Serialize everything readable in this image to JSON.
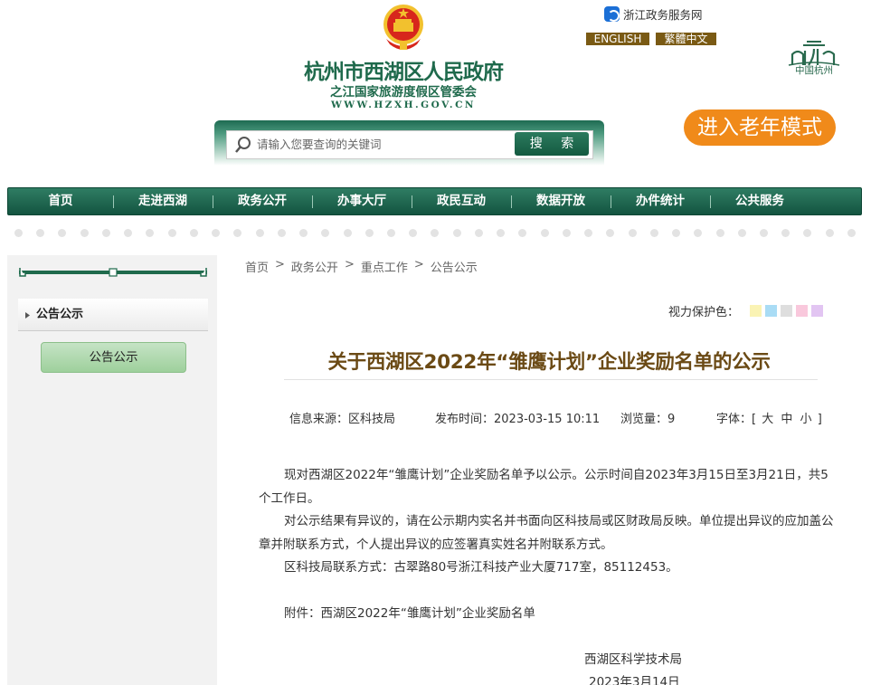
{
  "header": {
    "title": "杭州市西湖区人民政府",
    "subtitle": "之江国家旅游度假区管委会",
    "url": "WWW.HZXH.GOV.CN",
    "zj_link": "浙江政务服务网",
    "lang_en": "ENGLISH",
    "lang_tw": "繁體中文",
    "city_logo_text": "中国杭州",
    "elder_mode": "进入老年模式"
  },
  "search": {
    "placeholder": "请输入您要查询的关键词",
    "button": "搜 索"
  },
  "nav": [
    "首页",
    "走进西湖",
    "政务公开",
    "办事大厅",
    "政民互动",
    "数据开放",
    "办件统计",
    "公共服务"
  ],
  "sidebar": {
    "heading": "公告公示",
    "button": "公告公示"
  },
  "breadcrumb": [
    "首页",
    "政务公开",
    "重点工作",
    "公告公示"
  ],
  "vision": {
    "label": "视力保护色：",
    "colors": [
      "#faf3b4",
      "#a9dcf5",
      "#dedede",
      "#f9c8dc",
      "#e2c5f2"
    ]
  },
  "article": {
    "title": "关于西湖区2022年“雏鹰计划”企业奖励名单的公示",
    "source_label": "信息来源：",
    "source": "区科技局",
    "time_label": "发布时间：",
    "time": "2023-03-15 10:11",
    "views_label": "浏览量：",
    "views": "9",
    "font_label": "字体：",
    "font_open": "[",
    "font_large": "大",
    "font_medium": "中",
    "font_small": "小",
    "font_close": "]",
    "p1": "现对西湖区2022年“雏鹰计划”企业奖励名单予以公示。公示时间自2023年3月15日至3月21日，共5个工作日。",
    "p2": "对公示结果有异议的，请在公示期内实名并书面向区科技局或区财政局反映。单位提出异议的应加盖公章并附联系方式，个人提出异议的应签署真实姓名并附联系方式。",
    "p3": "区科技局联系方式：古翠路80号浙江科技产业大厦717室，85112453。",
    "attachment": "附件：西湖区2022年“雏鹰计划”企业奖励名单",
    "sign_org": "西湖区科学技术局",
    "sign_date": "2023年3月14日"
  }
}
